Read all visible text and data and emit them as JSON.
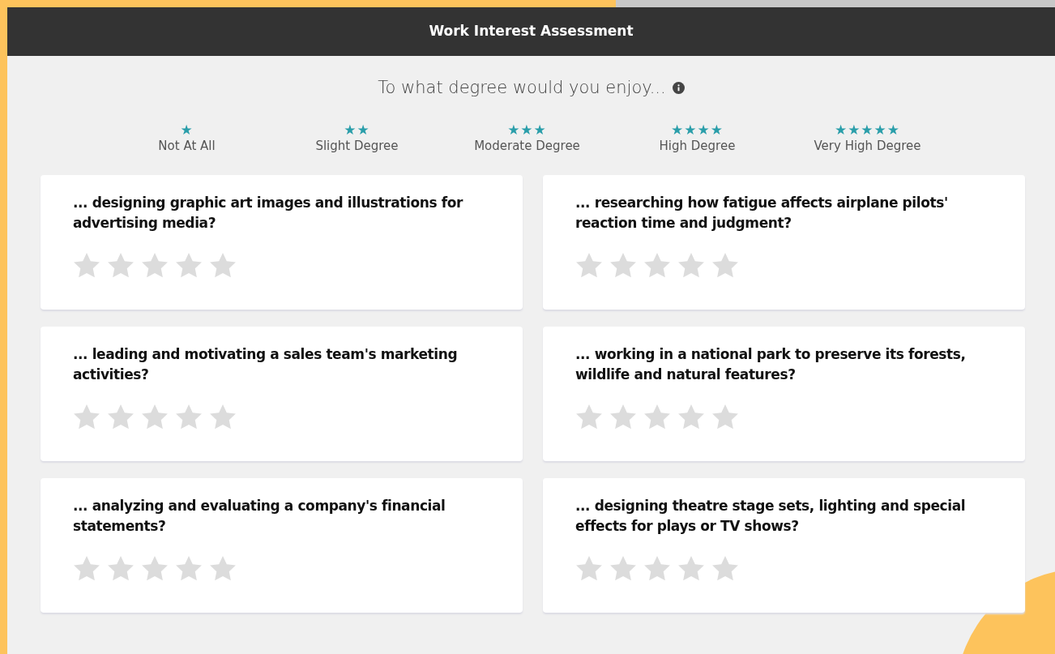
{
  "header": {
    "title": "Work Interest Assessment"
  },
  "prompt": {
    "text": "To what degree would you enjoy..."
  },
  "scale": [
    {
      "icon": "★",
      "label": "Not At All"
    },
    {
      "icon": "★★",
      "label": "Slight Degree"
    },
    {
      "icon": "★★★",
      "label": "Moderate Degree"
    },
    {
      "icon": "★★★★",
      "label": "High Degree"
    },
    {
      "icon": "★★★★★",
      "label": "Very High Degree"
    }
  ],
  "questions": [
    {
      "text": "... designing graphic art images and illustrations for advertising media?",
      "stars": 0
    },
    {
      "text": "... researching how fatigue affects airplane pilots' reaction time and judgment?",
      "stars": 0
    },
    {
      "text": "... leading and motivating a sales team's marketing activities?",
      "stars": 0
    },
    {
      "text": "... working in a national park to preserve its forests, wildlife and natural features?",
      "stars": 0
    },
    {
      "text": "... analyzing and evaluating a company's financial statements?",
      "stars": 0
    },
    {
      "text": "... designing theatre stage sets, lighting and special effects for plays or TV shows?",
      "stars": 0
    }
  ]
}
